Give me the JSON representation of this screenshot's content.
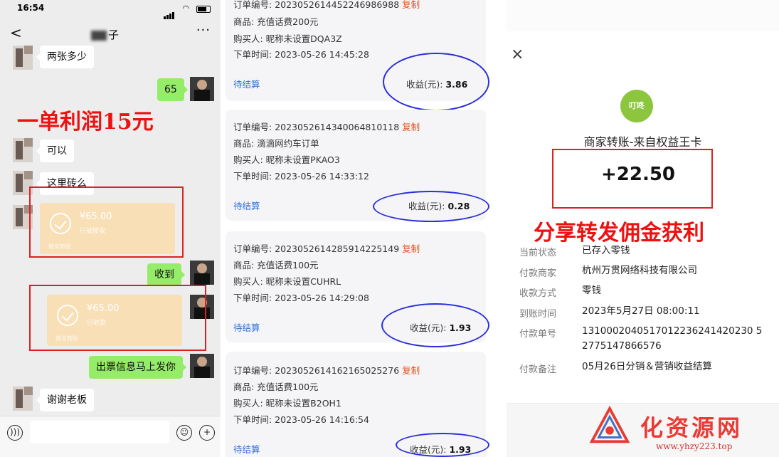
{
  "chat": {
    "status_time": "16:54",
    "contact_name": "子",
    "back_glyph": "<",
    "more_glyph": "···",
    "messages": [
      {
        "side": "left",
        "text": "两张多少"
      },
      {
        "side": "right",
        "text": "65"
      },
      {
        "side": "left",
        "text": "可以"
      },
      {
        "side": "left",
        "text": "这里砖么"
      },
      {
        "side": "right",
        "text": "收到"
      },
      {
        "side": "right",
        "text": "出票信息马上发你"
      },
      {
        "side": "left",
        "text": "谢谢老板"
      }
    ],
    "transfers": [
      {
        "amount": "¥65.00",
        "status": "已被接收",
        "label": "微信转账"
      },
      {
        "amount": "¥65.00",
        "status": "已收款",
        "label": "微信转账"
      }
    ],
    "banner": "一单利润15元",
    "icons": {
      "voice": "voice-icon",
      "emoji": "emoji-icon",
      "plus": "plus-icon"
    }
  },
  "orders": {
    "copy_label": "复制",
    "pending_label": "待结算",
    "earn_label": "收益(元):",
    "cards": [
      {
        "order_no_label": "订单编号: ",
        "order_no": "2023052614452246986988",
        "product": "商品: 充值话费200元",
        "buyer": "购买人: 昵称未设置DQA3Z",
        "time": "下单时间: 2023-05-26 14:45:28",
        "earning": "3.86"
      },
      {
        "order_no_label": "订单编号: ",
        "order_no": "2023052614340064810118",
        "product": "商品: 滴滴网约车订单",
        "buyer": "购买人: 昵称未设置PKAO3",
        "time": "下单时间: 2023-05-26 14:33:12",
        "earning": "0.28"
      },
      {
        "order_no_label": "订单编号: ",
        "order_no": "2023052614285914225149",
        "product": "商品: 充值话费100元",
        "buyer": "购买人: 昵称未设置CUHRL",
        "time": "下单时间: 2023-05-26 14:29:08",
        "earning": "1.93"
      },
      {
        "order_no_label": "订单编号: ",
        "order_no": "2023052614162165025276",
        "product": "商品: 充值话费100元",
        "buyer": "购买人: 昵称未设置B2OH1",
        "time": "下单时间: 2023-05-26 14:16:54",
        "earning": "1.93"
      }
    ]
  },
  "receipt": {
    "close_glyph": "×",
    "logo_text": "叮咚",
    "title": "商家转账-来自权益王卡",
    "amount": "+22.50",
    "banner": "分享转发佣金获利",
    "details": [
      {
        "key": "当前状态",
        "value": "已存入零钱"
      },
      {
        "key": "付款商家",
        "value": "杭州万贯网络科技有限公司"
      },
      {
        "key": "收款方式",
        "value": "零钱"
      },
      {
        "key": "到账时间",
        "value": "2023年5月27日 08:00:11"
      },
      {
        "key": "付款单号",
        "value": "1310002040517012236241420230 5",
        "value2": "2775147866576"
      },
      {
        "key": "付款备注",
        "value": "05月26日分销＆营销收益结算"
      }
    ]
  },
  "watermark": {
    "text": "化资源网",
    "url": "www.yhzy223.top"
  },
  "colors": {
    "wechat_green": "#95ec69",
    "highlight_red": "#e02020",
    "ellipse_blue": "#2a2fd8",
    "pending_blue": "#2f6fd8",
    "copy_orange": "#e4531f",
    "transfer_orange": "#f8dfb6"
  }
}
